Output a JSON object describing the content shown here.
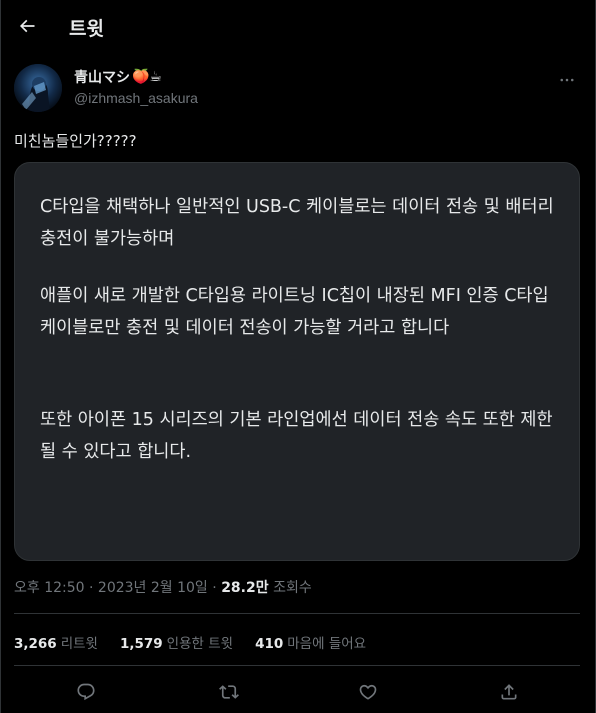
{
  "header": {
    "title": "트윗"
  },
  "author": {
    "display_name": "青山マシ",
    "emojis": "🍑☕",
    "handle": "@izhmash_asakura"
  },
  "tweet": {
    "text": "미친놈들인가?????"
  },
  "card": {
    "para1": "C타입을 채택하나 일반적인 USB-C 케이블로는 데이터 전송 및 배터리 충전이 불가능하며",
    "para2": "애플이 새로 개발한 C타입용 라이트닝 IC칩이 내장된 MFI 인증 C타입 케이블로만 충전 및 데이터 전송이 가능할 거라고 합니다",
    "para3": "또한 아이폰 15 시리즈의 기본 라인업에선 데이터 전송 속도 또한 제한될 수 있다고 합니다."
  },
  "meta": {
    "time": "오후 12:50",
    "date": "2023년 2월 10일",
    "separator": "·",
    "views_count": "28.2만",
    "views_label": "조회수"
  },
  "stats": {
    "retweets": {
      "count": "3,266",
      "label": "리트윗"
    },
    "quotes": {
      "count": "1,579",
      "label": "인용한 트윗"
    },
    "likes": {
      "count": "410",
      "label": "마음에 들어요"
    }
  },
  "icons": {
    "back": "arrow-left-icon",
    "more": "more-horizontal-icon",
    "reply": "reply-icon",
    "retweet": "retweet-icon",
    "like": "heart-icon",
    "share": "share-icon"
  },
  "colors": {
    "background": "#000000",
    "card": "#202327",
    "text": "#e7e9ea",
    "muted": "#71767b",
    "border": "#2f3336"
  }
}
